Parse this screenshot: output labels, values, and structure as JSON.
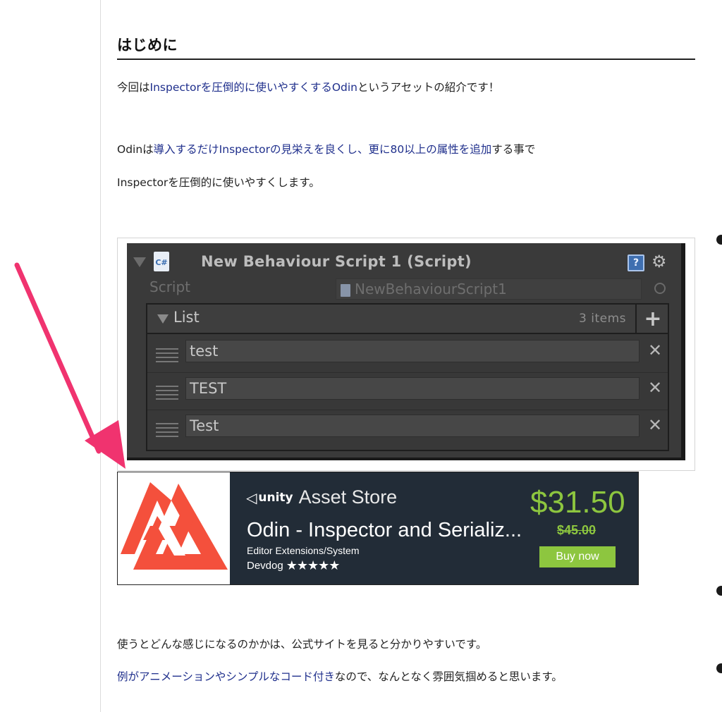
{
  "article": {
    "heading": "はじめに",
    "p1": {
      "t1": "今回は",
      "link1": "Inspectorを圧倒的に使いやすくするOdin",
      "t2": "というアセットの紹介です！"
    },
    "p2": {
      "t1": "Odinは",
      "link1": "導入するだけInspectorの見栄えを良くし、更に80以上の属性を追加",
      "t2": "する事で"
    },
    "p3": "Inspectorを圧倒的に使いやすくします。",
    "p4": "使うとどんな感じになるのかかは、公式サイトを見ると分かりやすいです。",
    "p5": {
      "link1": "例がアニメーションやシンプルなコード付き",
      "t2": "なので、なんとなく雰囲気掴めると思います。"
    }
  },
  "inspector": {
    "cs_icon": "C#",
    "title": "New Behaviour Script 1 (Script)",
    "help_icon": "?",
    "gear_icon": "⚙",
    "script_label": "Script",
    "script_value": "NewBehaviourScript1",
    "list": {
      "label": "List",
      "count": "3 items",
      "add_icon": "+",
      "items": [
        "test",
        "TEST",
        "Test"
      ],
      "remove_icon": "✕"
    }
  },
  "asset_store": {
    "unity_glyph": "◁",
    "unity_word": "unity",
    "store_name": "Asset Store",
    "product_title": "Odin - Inspector and Serializ...",
    "category": "Editor Extensions/System",
    "publisher": "Devdog",
    "stars": "★★★★★",
    "price": "$31.50",
    "old_price": "$45.00",
    "buy_label": "Buy now",
    "logo_color": "#f4503c",
    "price_color": "#8dc63f"
  },
  "arrow_color": "#f0336f"
}
